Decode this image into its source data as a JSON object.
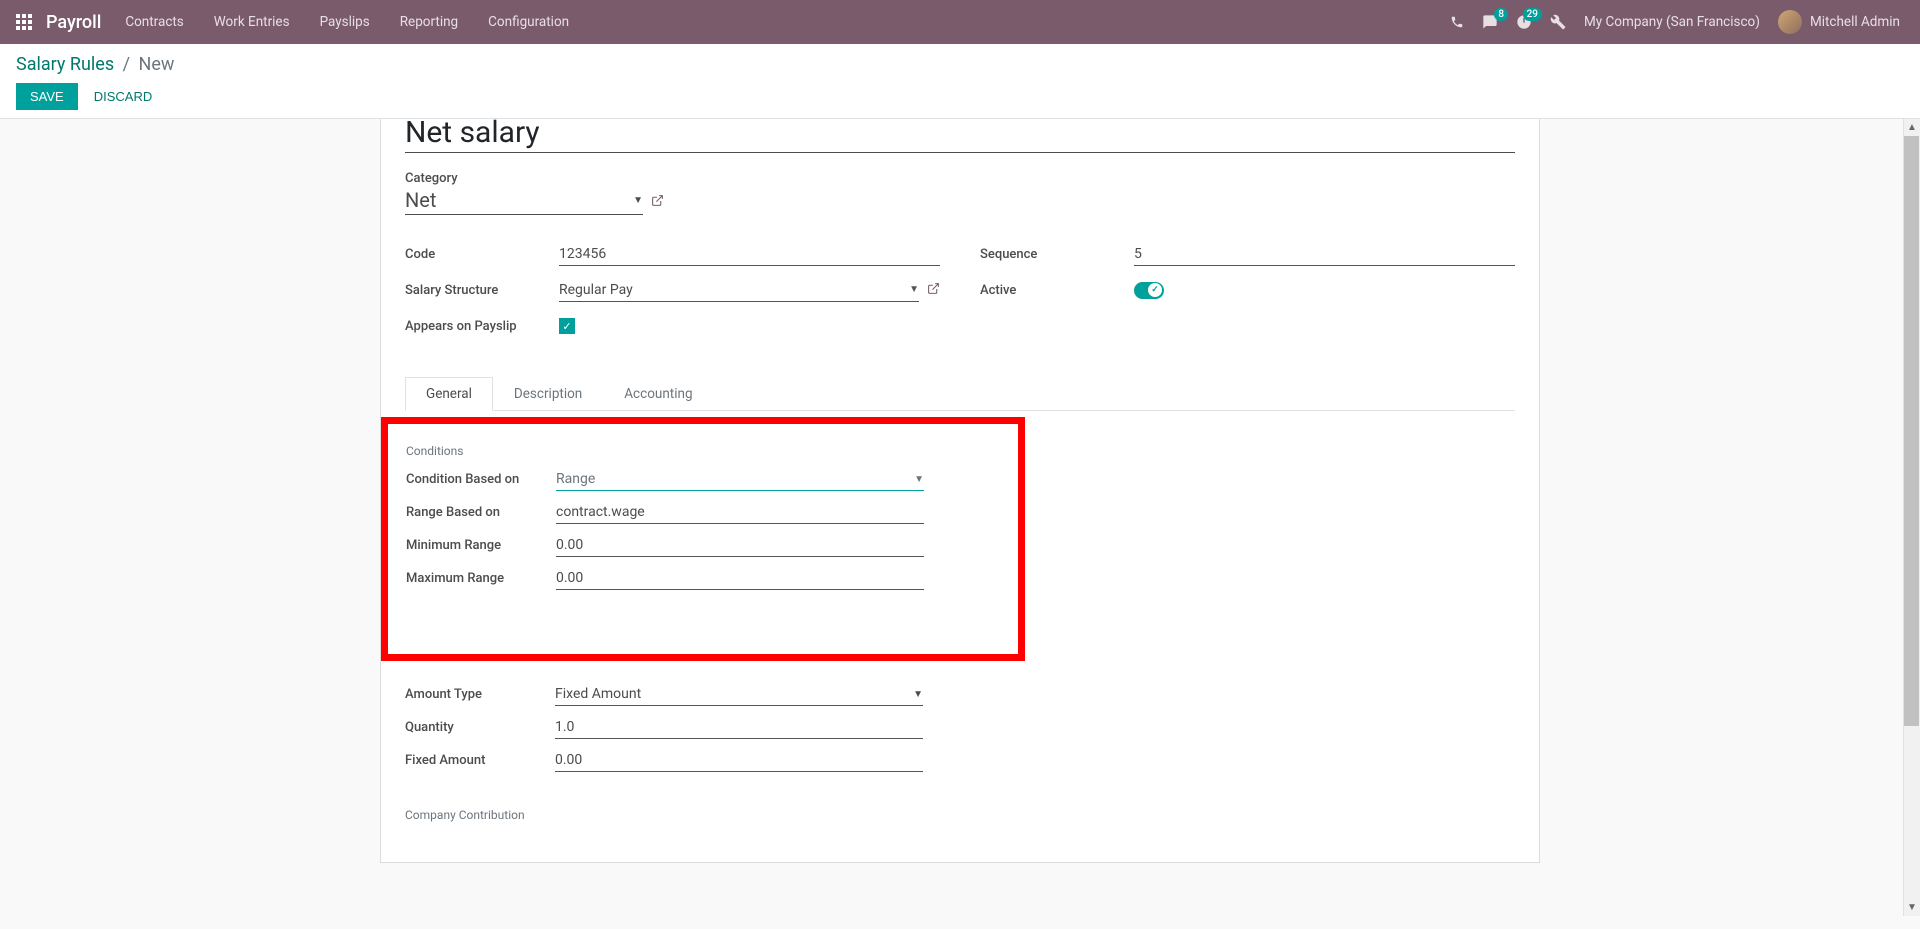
{
  "navbar": {
    "brand": "Payroll",
    "menu": [
      "Contracts",
      "Work Entries",
      "Payslips",
      "Reporting",
      "Configuration"
    ],
    "msg_badge": "8",
    "clock_badge": "29",
    "company": "My Company (San Francisco)",
    "user": "Mitchell Admin"
  },
  "breadcrumbs": {
    "parent": "Salary Rules",
    "sep": "/",
    "current": "New"
  },
  "actions": {
    "save": "SAVE",
    "discard": "DISCARD"
  },
  "record": {
    "name": "Net salary",
    "category_label": "Category",
    "category_value": "Net",
    "fields_left": {
      "code_label": "Code",
      "code_value": "123456",
      "struct_label": "Salary Structure",
      "struct_value": "Regular Pay",
      "appears_label": "Appears on Payslip"
    },
    "fields_right": {
      "seq_label": "Sequence",
      "seq_value": "5",
      "active_label": "Active"
    }
  },
  "tabs": [
    "General",
    "Description",
    "Accounting"
  ],
  "conditions": {
    "section": "Conditions",
    "based_label": "Condition Based on",
    "based_value": "Range",
    "range_on_label": "Range Based on",
    "range_on_value": "contract.wage",
    "min_label": "Minimum Range",
    "min_value": "0.00",
    "max_label": "Maximum Range",
    "max_value": "0.00"
  },
  "computation": {
    "amount_type_label": "Amount Type",
    "amount_type_value": "Fixed Amount",
    "quantity_label": "Quantity",
    "quantity_value": "1.0",
    "fixed_label": "Fixed Amount",
    "fixed_value": "0.00"
  },
  "contribution_section": "Company Contribution"
}
